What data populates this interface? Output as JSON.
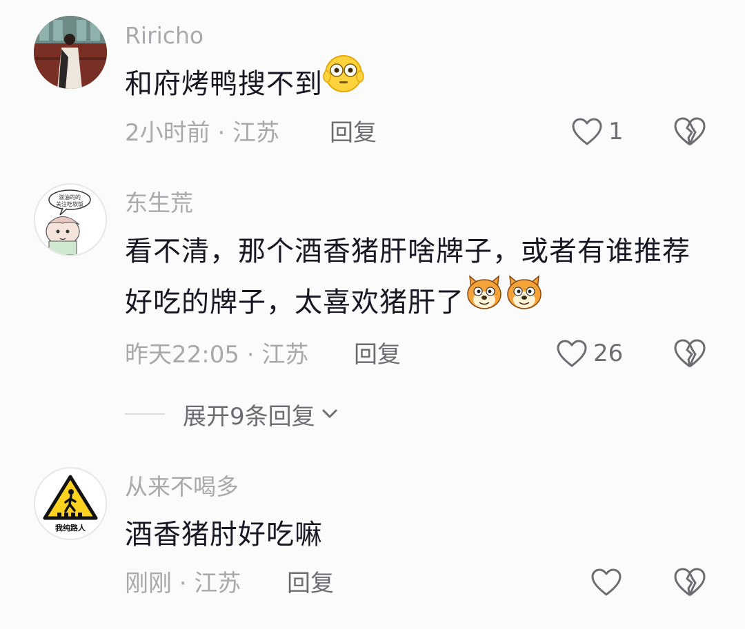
{
  "colors": {
    "background": "#fbfbfb",
    "username": "#a9a9ad",
    "content": "#161823",
    "meta": "#a9a9ad",
    "action": "#6b6d73"
  },
  "comments": [
    {
      "username": "Riricho",
      "content": "和府烤鸭搜不到",
      "emoji": "flushed-face-emoji",
      "time_location": "2小时前 · 江苏",
      "reply_label": "回复",
      "like_count": "1"
    },
    {
      "username": "东生荒",
      "content": "看不清，那个酒香猪肝啥牌子，或者有谁推荐好吃的牌子，太喜欢猪肝了",
      "emoji": "dog-face-emoji",
      "time_location": "昨天22:05 · 江苏",
      "reply_label": "回复",
      "like_count": "26",
      "expand_label": "展开9条回复"
    },
    {
      "username": "从来不喝多",
      "content": "酒香猪肘好吃嘛",
      "avatar_caption": "我纯路人",
      "time_location": "刚刚 · 江苏",
      "reply_label": "回复",
      "like_count": ""
    }
  ],
  "avatar_doodle_text": "滋油的的 关注吃软饭",
  "icons": {
    "like": "heart-outline-icon",
    "dislike": "broken-heart-icon",
    "expand": "chevron-down-icon"
  }
}
